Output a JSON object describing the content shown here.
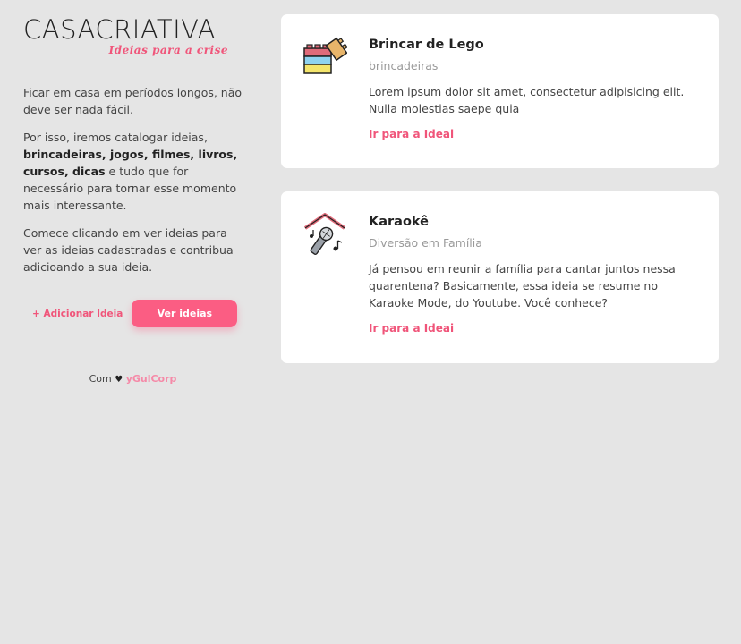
{
  "brand": {
    "name_bold": "CASA",
    "name_light": "CRIATIVA",
    "tagline": "Ideias para a crise"
  },
  "intro": {
    "p1": "Ficar em casa em períodos longos, não deve ser nada fácil.",
    "p2_start": "Por isso, iremos catalogar ideias,",
    "p2_bold": "brincadeiras, jogos, filmes, livros, cursos, dicas",
    "p2_end": "e tudo que for necessário para tornar esse momento mais interessante.",
    "p3": "Comece clicando em ver ideias para ver as ideias cadastradas e contribua adicioando a sua ideia."
  },
  "actions": {
    "add_label": "+ Adicionar Ideia",
    "view_label": "Ver ideias"
  },
  "credit": {
    "prefix": "Com",
    "heart": "♥",
    "corp": "yGulCorp"
  },
  "ideas": [
    {
      "title": "Brincar de Lego",
      "category": "brincadeiras",
      "description": "Lorem ipsum dolor sit amet, consectetur adipisicing elit. Nulla molestias saepe quia",
      "link": "Ir para a Ideai",
      "icon": "lego-icon"
    },
    {
      "title": "Karaokê",
      "category": "Diversão em Família",
      "description": "Já pensou em reunir a família para cantar juntos nessa quarentena? Basicamente, essa ideia se resume no Karaoke Mode, do Youtube. Você conhece?",
      "link": "Ir para a Ideai",
      "icon": "karaoke-microphone-icon"
    }
  ],
  "colors": {
    "accent": "#fb5d83",
    "link": "#f0557a",
    "background": "#e5e5e5"
  }
}
